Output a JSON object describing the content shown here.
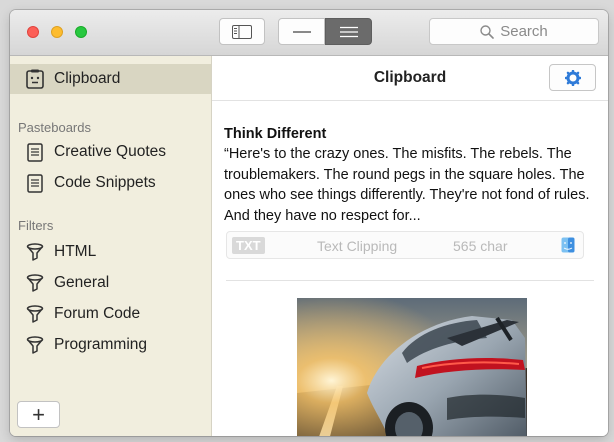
{
  "toolbar": {
    "search_placeholder": "Search"
  },
  "sidebar": {
    "clipboard_label": "Clipboard",
    "pasteboards_heading": "Pasteboards",
    "pasteboards": [
      {
        "label": "Creative Quotes"
      },
      {
        "label": "Code Snippets"
      }
    ],
    "filters_heading": "Filters",
    "filters": [
      {
        "label": "HTML"
      },
      {
        "label": "General"
      },
      {
        "label": "Forum Code"
      },
      {
        "label": "Programming"
      }
    ],
    "add_label": "+"
  },
  "main": {
    "title": "Clipboard",
    "clip": {
      "title": "Think Different",
      "body": "“Here's to the crazy ones. The misfits. The rebels. The troublemakers. The round pegs in the square holes. The ones who see things differently. They're not fond of rules. And they have no respect for...",
      "badge": "TXT",
      "type": "Text Clipping",
      "chars": "565 char"
    }
  },
  "colors": {
    "sidebar_bg": "#f1eede",
    "sidebar_selected": "#d9d6c2",
    "accent": "#2f7bd8",
    "close": "#fc5f57",
    "minimize": "#fdbc2e",
    "zoom": "#28c840"
  },
  "icons": {
    "clipboard": "clipboard-icon",
    "pasteboard": "document-icon",
    "filter": "funnel-icon",
    "settings": "gear-icon",
    "search": "magnifier-icon",
    "finder": "finder-icon"
  }
}
